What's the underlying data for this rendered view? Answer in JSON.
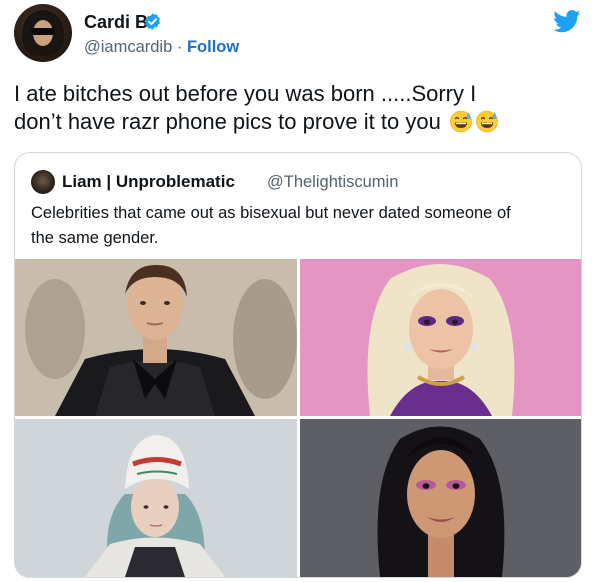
{
  "tweet": {
    "author": {
      "name": "Cardi B",
      "handle": "@iamcardib",
      "separator": "·",
      "follow_label": "Follow",
      "verified_icon": "verified-badge-icon"
    },
    "platform_icon": "twitter-bird-icon",
    "text_lines": [
      "I ate bitches out before you was born .....Sorry I",
      "don’t have razr phone pics to prove it to you"
    ],
    "emojis": [
      "grinning-sweat-emoji",
      "grinning-sweat-emoji"
    ],
    "quoted": {
      "author_name": "Liam | Unproblematic",
      "handle": "@Thelightiscumin",
      "text_lines": [
        "Celebrities that came out as bisexual but never dated someone of",
        "the same gender."
      ],
      "photos": [
        {
          "desc": "man-with-black-bow-blouse-photo"
        },
        {
          "desc": "blonde-woman-purple-eyeshadow-photo"
        },
        {
          "desc": "girl-white-beanie-teal-hair-photo"
        },
        {
          "desc": "woman-long-black-hair-pink-eyeshadow-photo"
        }
      ]
    }
  },
  "colors": {
    "twitter_blue": "#1da1f2",
    "follow_blue": "#1d6fc7",
    "secondary_text": "#536471",
    "border": "#cfd9de"
  }
}
